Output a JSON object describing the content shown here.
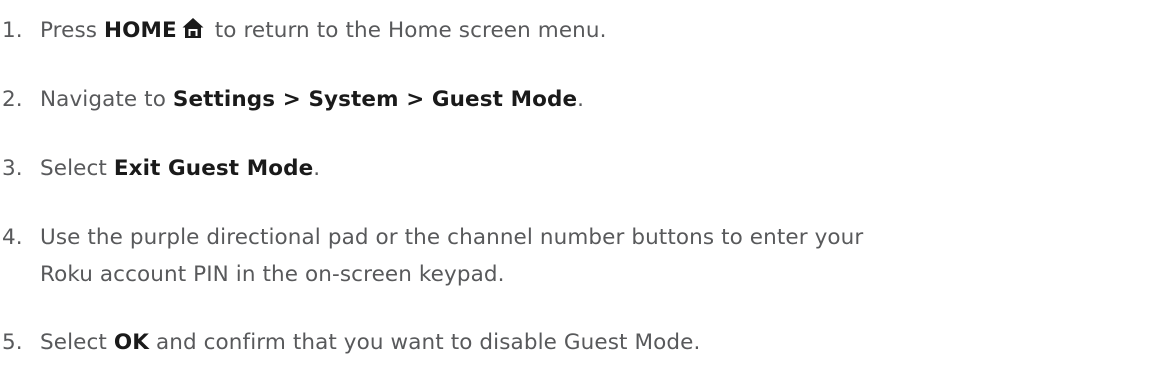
{
  "steps": [
    {
      "number": "1.",
      "pre": "Press ",
      "bold": "HOME",
      "icon": "home-icon",
      "post": " to return to the Home screen menu."
    },
    {
      "number": "2.",
      "pre": "Navigate to ",
      "bold": "Settings > System > Guest Mode",
      "post": "."
    },
    {
      "number": "3.",
      "pre": "Select ",
      "bold": "Exit Guest Mode",
      "post": "."
    },
    {
      "number": "4.",
      "line1": "Use the purple directional pad or the channel number buttons to enter your",
      "line2": "Roku account PIN in the on-screen keypad."
    },
    {
      "number": "5.",
      "pre": "Select ",
      "bold": "OK",
      "post": " and confirm that you want to disable Guest Mode."
    }
  ],
  "colors": {
    "text": "#58595b",
    "bold_text": "#1a1a1a",
    "background": "#ffffff"
  }
}
